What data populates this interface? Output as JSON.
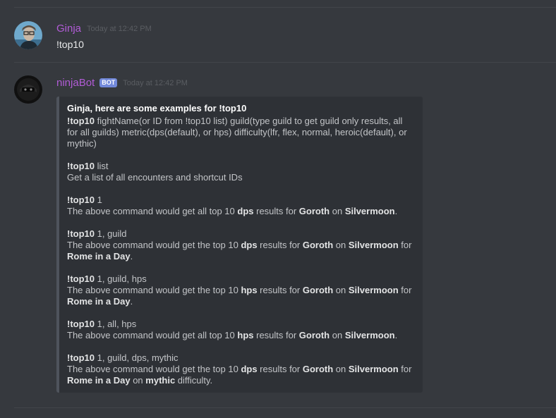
{
  "messages": [
    {
      "author": "Ginja",
      "timestamp": "Today at 12:42 PM",
      "text": "!top10",
      "avatar_icon": "user-avatar-icon"
    },
    {
      "author": "ninjaBot",
      "bot_tag": "BOT",
      "timestamp": "Today at 12:42 PM",
      "avatar_icon": "ninja-avatar-icon",
      "embed": {
        "title": "Ginja, here are some examples for !top10",
        "usage_cmd": "!top10",
        "usage_text": " fightName(or ID from !top10 list) guild(type guild to get guild only results, all for all guilds) metric(dps(default), or hps) difficulty(lfr, flex, normal, heroic(default), or mythic)",
        "examples": [
          {
            "cmd": "!top10",
            "args": " list",
            "desc": [
              {
                "t": "Get a list of all encounters and shortcut IDs",
                "b": false
              }
            ]
          },
          {
            "cmd": "!top10",
            "args": " 1",
            "desc": [
              {
                "t": "The above command would get all top 10 ",
                "b": false
              },
              {
                "t": "dps",
                "b": true
              },
              {
                "t": " results for ",
                "b": false
              },
              {
                "t": "Goroth",
                "b": true
              },
              {
                "t": " on ",
                "b": false
              },
              {
                "t": "Silvermoon",
                "b": true
              },
              {
                "t": ".",
                "b": false
              }
            ]
          },
          {
            "cmd": "!top10",
            "args": " 1, guild",
            "desc": [
              {
                "t": "The above command would get the top 10 ",
                "b": false
              },
              {
                "t": "dps",
                "b": true
              },
              {
                "t": " results for ",
                "b": false
              },
              {
                "t": "Goroth",
                "b": true
              },
              {
                "t": " on ",
                "b": false
              },
              {
                "t": "Silvermoon",
                "b": true
              },
              {
                "t": " for ",
                "b": false
              },
              {
                "t": "Rome in a Day",
                "b": true
              },
              {
                "t": ".",
                "b": false
              }
            ]
          },
          {
            "cmd": "!top10",
            "args": " 1, guild, hps",
            "desc": [
              {
                "t": "The above command would get the top 10 ",
                "b": false
              },
              {
                "t": "hps",
                "b": true
              },
              {
                "t": " results for ",
                "b": false
              },
              {
                "t": "Goroth",
                "b": true
              },
              {
                "t": " on ",
                "b": false
              },
              {
                "t": "Silvermoon",
                "b": true
              },
              {
                "t": " for ",
                "b": false
              },
              {
                "t": "Rome in a Day",
                "b": true
              },
              {
                "t": ".",
                "b": false
              }
            ]
          },
          {
            "cmd": "!top10",
            "args": " 1, all, hps",
            "desc": [
              {
                "t": "The above command would get all top 10 ",
                "b": false
              },
              {
                "t": "hps",
                "b": true
              },
              {
                "t": " results for ",
                "b": false
              },
              {
                "t": "Goroth",
                "b": true
              },
              {
                "t": " on ",
                "b": false
              },
              {
                "t": "Silvermoon",
                "b": true
              },
              {
                "t": ".",
                "b": false
              }
            ]
          },
          {
            "cmd": "!top10",
            "args": " 1, guild, dps, mythic",
            "desc": [
              {
                "t": "The above command would get the top 10 ",
                "b": false
              },
              {
                "t": "dps",
                "b": true
              },
              {
                "t": " results for ",
                "b": false
              },
              {
                "t": "Goroth",
                "b": true
              },
              {
                "t": " on ",
                "b": false
              },
              {
                "t": "Silvermoon",
                "b": true
              },
              {
                "t": " for ",
                "b": false
              },
              {
                "t": "Rome in a Day",
                "b": true
              },
              {
                "t": " on ",
                "b": false
              },
              {
                "t": "mythic",
                "b": true
              },
              {
                "t": " difficulty.",
                "b": false
              }
            ]
          }
        ]
      }
    }
  ],
  "colors": {
    "background": "#36393e",
    "username": "#b15cd6",
    "bot_tag": "#7289da",
    "embed_bg": "#2e3136",
    "embed_border": "#4f545c"
  }
}
